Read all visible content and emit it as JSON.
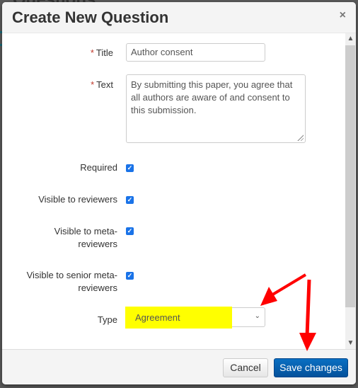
{
  "background": {
    "page_title": "Questions"
  },
  "modal": {
    "title": "Create New Question",
    "close_icon": "×"
  },
  "form": {
    "required_marker": "*",
    "title": {
      "label": "Title",
      "value": "Author consent",
      "required": true
    },
    "text": {
      "label": "Text",
      "value": "By submitting this paper, you agree that all authors are aware of and consent to this submission.",
      "required": true
    },
    "checkboxes": [
      {
        "label": "Required",
        "checked": true
      },
      {
        "label": "Visible to reviewers",
        "checked": true
      },
      {
        "label": "Visible to meta-reviewers",
        "checked": true
      },
      {
        "label": "Visible to senior meta-reviewers",
        "checked": true
      }
    ],
    "type": {
      "label": "Type",
      "selected": "Agreement",
      "highlight_color": "#ffff00"
    }
  },
  "footer": {
    "cancel_label": "Cancel",
    "save_label": "Save changes"
  },
  "scrollbar": {
    "up_icon": "^",
    "down_icon": "v"
  },
  "annotations": {
    "arrow_color": "#ff0000",
    "arrow_count": 2
  },
  "icons": {
    "check": "✓",
    "chevron": "⌄"
  }
}
